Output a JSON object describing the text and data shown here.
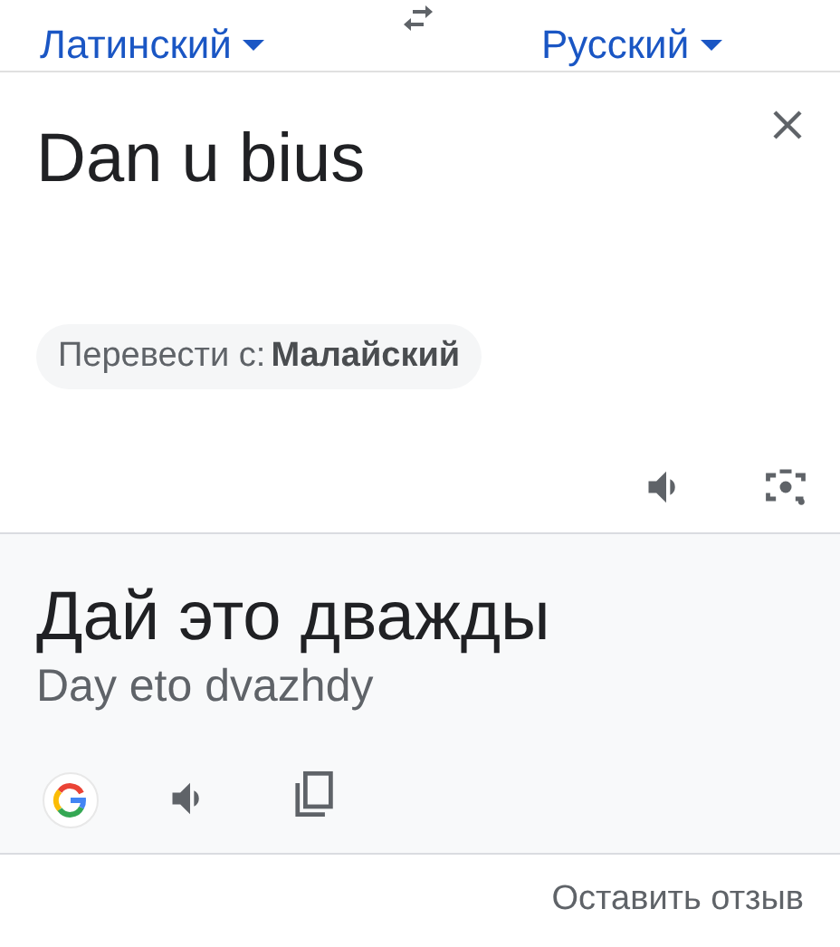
{
  "language_bar": {
    "source_language": "Латинский",
    "target_language": "Русский"
  },
  "source": {
    "text": "Dan u bius",
    "suggestion_label": "Перевести с:",
    "suggestion_language": "Малайский"
  },
  "result": {
    "translation": "Дай это дважды",
    "transliteration": "Day eto dvazhdy"
  },
  "footer": {
    "feedback_link": "Оставить отзыв"
  }
}
